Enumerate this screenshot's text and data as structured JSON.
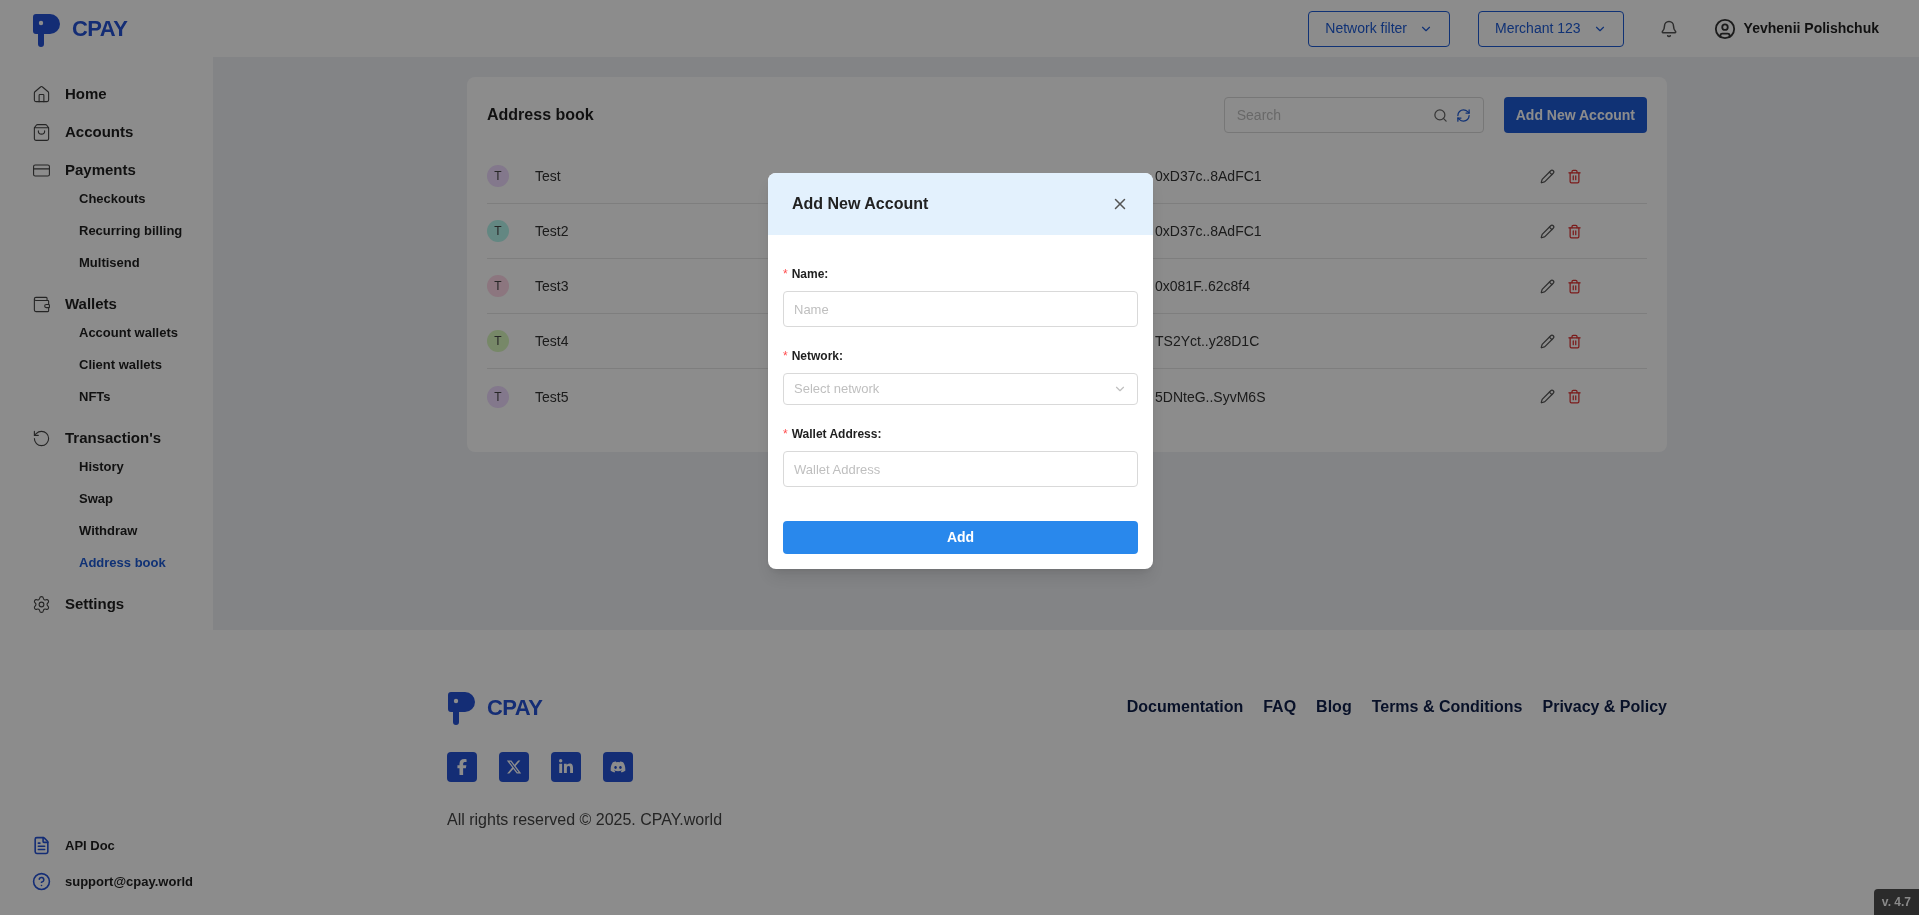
{
  "header": {
    "logo_text": "CPAY",
    "network_filter": "Network filter",
    "merchant": "Merchant 123",
    "user": "Yevhenii Polishchuk"
  },
  "sidebar": {
    "items": [
      {
        "label": "Home",
        "selected": false
      },
      {
        "label": "Accounts",
        "selected": false
      },
      {
        "label": "Payments",
        "selected": false,
        "children": [
          {
            "label": "Checkouts",
            "selected": false
          },
          {
            "label": "Recurring billing",
            "selected": false
          },
          {
            "label": "Multisend",
            "selected": false
          }
        ]
      },
      {
        "label": "Wallets",
        "selected": false,
        "children": [
          {
            "label": "Account wallets",
            "selected": false
          },
          {
            "label": "Client wallets",
            "selected": false
          },
          {
            "label": "NFTs",
            "selected": false
          }
        ]
      },
      {
        "label": "Transaction's",
        "selected": false,
        "children": [
          {
            "label": "History",
            "selected": false
          },
          {
            "label": "Swap",
            "selected": false
          },
          {
            "label": "Withdraw",
            "selected": false
          },
          {
            "label": "Address book",
            "selected": true
          }
        ]
      },
      {
        "label": "Settings",
        "selected": false
      }
    ],
    "footer_links": [
      "API Doc",
      "support@cpay.world"
    ]
  },
  "address_book": {
    "title": "Address book",
    "search_placeholder": "Search",
    "add_button": "Add New Account",
    "rows": [
      {
        "initial": "T",
        "name": "Test",
        "address": "0xD37c..8AdFC1",
        "color": "#83788c"
      },
      {
        "initial": "T",
        "name": "Test2",
        "address": "0xD37c..8AdFC1",
        "color": "#638782"
      },
      {
        "initial": "T",
        "name": "Test3",
        "address": "0x081F..62c8f4",
        "color": "#8c767f"
      },
      {
        "initial": "T",
        "name": "Test4",
        "address": "TS2Yct..y28D1C",
        "color": "#778868"
      },
      {
        "initial": "T",
        "name": "Test5",
        "address": "5DNteG..SyvM6S",
        "color": "#83788c"
      }
    ]
  },
  "modal": {
    "title": "Add New Account",
    "fields": [
      {
        "marker": "*",
        "label": "Name:",
        "placeholder": "Name",
        "kind": "input"
      },
      {
        "marker": "*",
        "label": "Network:",
        "placeholder": "Select network",
        "kind": "select"
      },
      {
        "marker": "*",
        "label": "Wallet Address:",
        "placeholder": "Wallet Address",
        "kind": "input"
      }
    ],
    "submit": "Add"
  },
  "footer": {
    "logo_text": "CPAY",
    "links": [
      "Documentation",
      "FAQ",
      "Blog",
      "Terms & Conditions",
      "Privacy & Policy"
    ],
    "copyright": "All rights reserved © 2025. CPAY.world"
  },
  "version": "v. 4.7"
}
